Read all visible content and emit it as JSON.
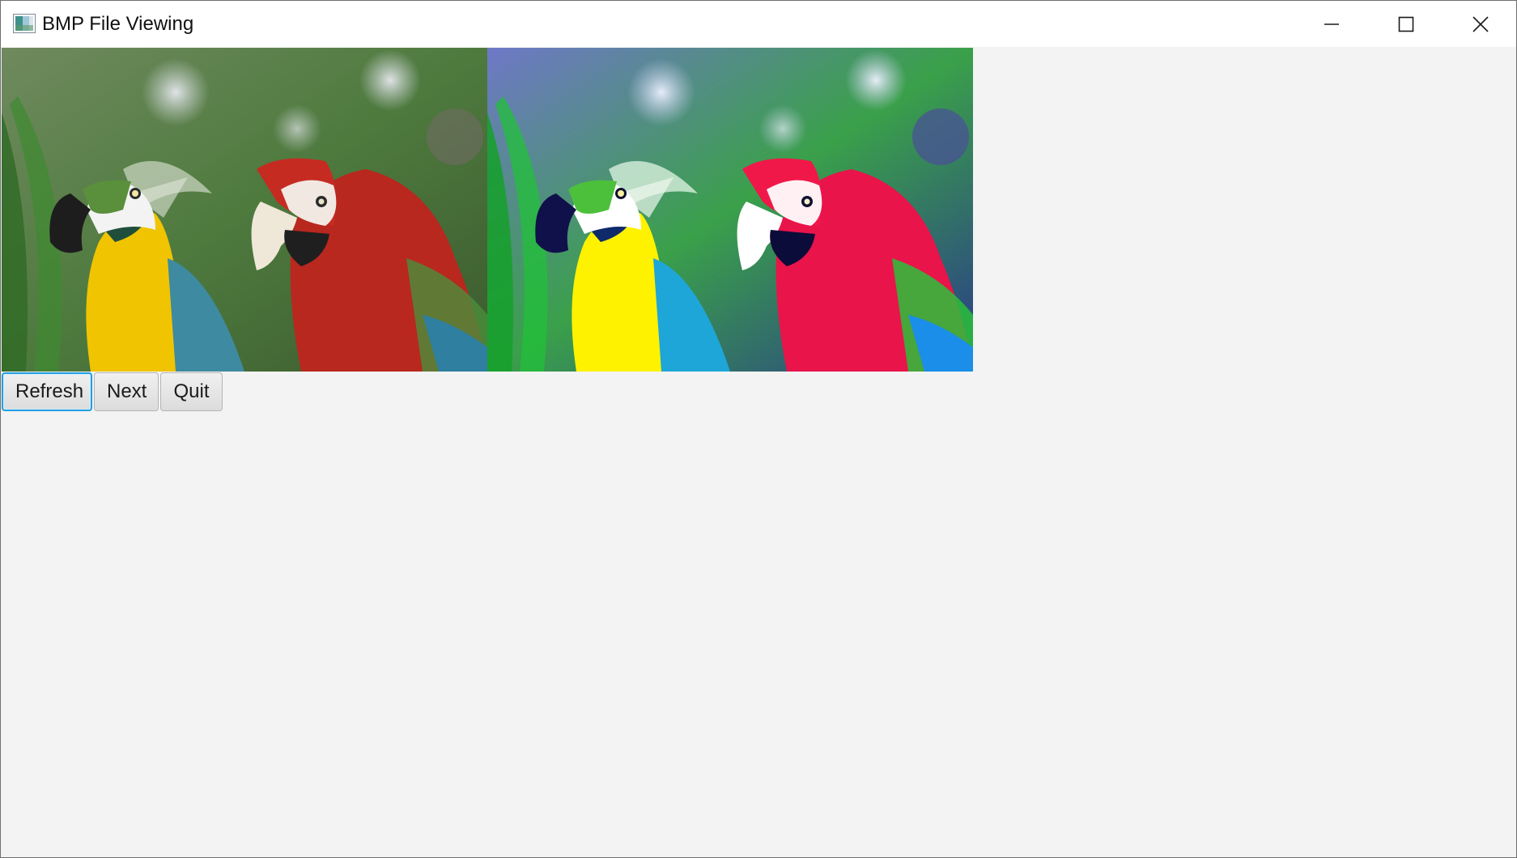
{
  "window": {
    "title": "BMP File Viewing",
    "controls": {
      "minimize": "minimize-icon",
      "maximize": "maximize-icon",
      "close": "close-icon"
    }
  },
  "images": [
    {
      "name": "original-bmp-image",
      "content": "two macaws parrots, muted colors"
    },
    {
      "name": "processed-bmp-image",
      "content": "two macaws parrots, saturated colors"
    }
  ],
  "buttons": {
    "refresh": "Refresh",
    "next": "Next",
    "quit": "Quit"
  },
  "colors": {
    "focus_border": "#1e9fe0",
    "background": "#f3f3f3",
    "titlebar": "#ffffff"
  }
}
